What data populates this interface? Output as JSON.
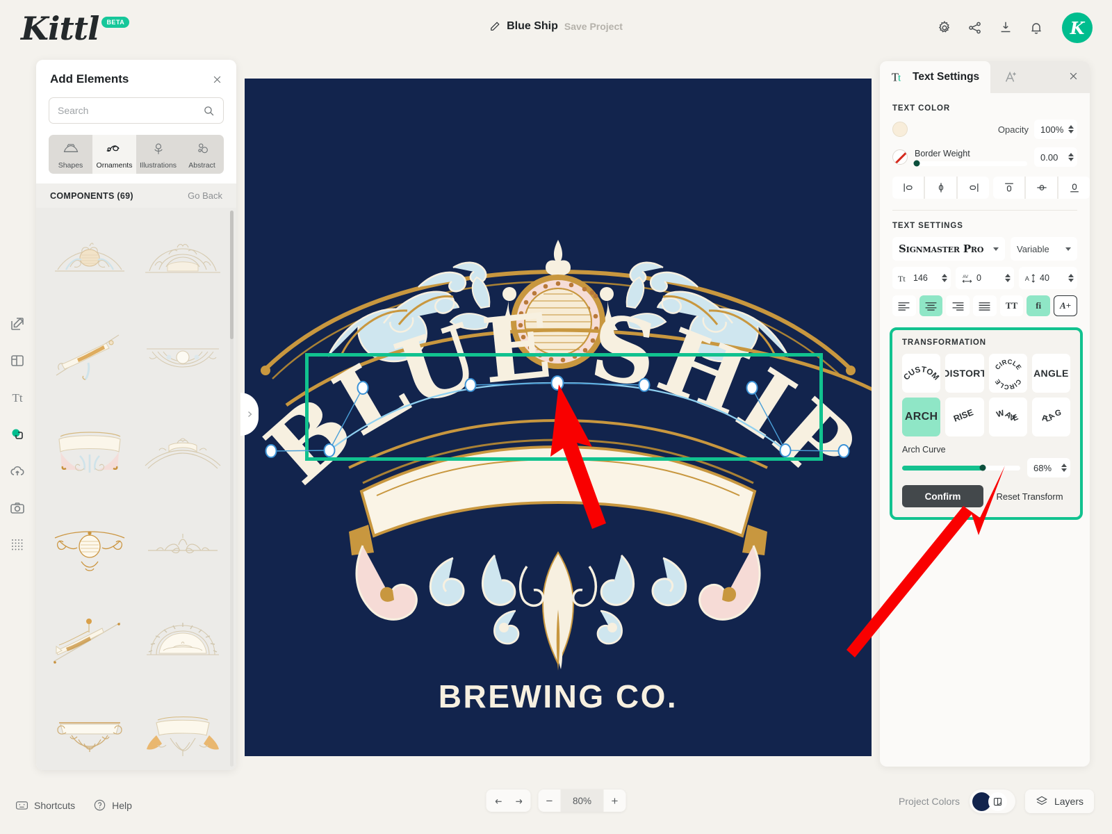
{
  "header": {
    "logo_text": "Kittl",
    "beta_badge": "BETA",
    "project_title": "Blue Ship",
    "save_label": "Save Project",
    "icons": [
      "gear-icon",
      "share-icon",
      "download-icon",
      "bell-icon"
    ],
    "avatar_letter": "K"
  },
  "rail": {
    "items": [
      {
        "name": "edit-tool",
        "icon": "pencil-square-icon"
      },
      {
        "name": "templates-tool",
        "icon": "layout-icon"
      },
      {
        "name": "text-tool",
        "icon": "text-icon"
      },
      {
        "name": "elements-tool",
        "icon": "shapes-icon"
      },
      {
        "name": "uploads-tool",
        "icon": "cloud-upload-icon"
      },
      {
        "name": "photos-tool",
        "icon": "camera-icon"
      },
      {
        "name": "textures-tool",
        "icon": "grid-dots-icon"
      }
    ]
  },
  "add_elements": {
    "title": "Add Elements",
    "search_placeholder": "Search",
    "search_value": "",
    "categories": [
      {
        "label": "Shapes",
        "icon": "shapes-icon",
        "active": false
      },
      {
        "label": "Ornaments",
        "icon": "ornament-swirl-icon",
        "active": true
      },
      {
        "label": "Illustrations",
        "icon": "flower-icon",
        "active": false
      },
      {
        "label": "Abstract",
        "icon": "abstract-blobs-icon",
        "active": false
      }
    ],
    "components_label": "COMPONENTS (69)",
    "go_back_label": "Go Back",
    "thumbnails": [
      {
        "name": "ornament-crown-oval"
      },
      {
        "name": "ornament-filigree-arch"
      },
      {
        "name": "ornament-diagonal-banner"
      },
      {
        "name": "ornament-fan-medallion"
      },
      {
        "name": "ornament-scroll-banner"
      },
      {
        "name": "ornament-small-crown-arch"
      },
      {
        "name": "ornament-oval-wings"
      },
      {
        "name": "ornament-flourish-divider"
      },
      {
        "name": "ornament-flag-banner"
      },
      {
        "name": "ornament-sunburst-arch"
      },
      {
        "name": "ornament-plaque-base"
      },
      {
        "name": "ornament-ribbon-scroll"
      }
    ]
  },
  "canvas": {
    "artwork_title": "BLUE SHIP",
    "artwork_subtitle": "BREWING CO.",
    "background_color": "#12244d",
    "cream_color": "#f7f0e0",
    "gold_color": "#c8973f",
    "lightblue_color": "#cfe6ef",
    "pink_color": "#f6dbd6",
    "selection_color": "#11c28f",
    "annotation_arrow_color": "#f90000"
  },
  "text_settings": {
    "tab_label": "Text Settings",
    "tab_icon": "Tt",
    "tab2_icon": "text-effects-icon",
    "close_icon": "close-icon",
    "text_color_label": "TEXT COLOR",
    "text_color_swatch": "#f8edda",
    "opacity_label": "Opacity",
    "opacity_value": "100%",
    "border_weight_label": "Border Weight",
    "border_weight_value": "0.00",
    "border_color": "none",
    "align_buttons": [
      {
        "name": "align-left-edge",
        "icon": "align-h-left-icon"
      },
      {
        "name": "align-h-center",
        "icon": "align-h-center-icon"
      },
      {
        "name": "align-right-edge",
        "icon": "align-h-right-icon"
      },
      {
        "name": "align-top-edge",
        "icon": "align-v-top-icon"
      },
      {
        "name": "align-v-center",
        "icon": "align-v-center-icon"
      },
      {
        "name": "align-bottom-edge",
        "icon": "align-v-bottom-icon"
      }
    ],
    "settings_label": "TEXT SETTINGS",
    "font_family": "Signmaster Pro",
    "font_variant": "Variable",
    "font_size_label": "Tt",
    "font_size": "146",
    "letter_spacing_label": "AV",
    "letter_spacing": "0",
    "line_height_label": "A",
    "line_height": "40",
    "paragraph_buttons": [
      {
        "name": "text-align-left",
        "icon": "align-text-left-icon",
        "active": false
      },
      {
        "name": "text-align-center",
        "icon": "align-text-center-icon",
        "active": true
      },
      {
        "name": "text-align-right",
        "icon": "align-text-right-icon",
        "active": false
      },
      {
        "name": "text-align-justify",
        "icon": "align-text-justify-icon",
        "active": false
      },
      {
        "name": "uppercase-toggle",
        "label": "TT",
        "active": false
      },
      {
        "name": "ligatures-toggle",
        "label": "fi",
        "active": true
      },
      {
        "name": "text-effects-button",
        "label": "A+",
        "active": false
      }
    ]
  },
  "transformation": {
    "label": "TRANSFORMATION",
    "presets": [
      {
        "name": "custom",
        "label": "CUSTOM",
        "style": "arch",
        "active": false
      },
      {
        "name": "distort",
        "label": "DISTORT",
        "style": "flat",
        "active": false
      },
      {
        "name": "circle",
        "label": "CIRCLE",
        "style": "circle",
        "active": false
      },
      {
        "name": "angle",
        "label": "ANGLE",
        "style": "flat",
        "active": false
      },
      {
        "name": "arch",
        "label": "ARCH",
        "style": "flat",
        "active": true
      },
      {
        "name": "rise",
        "label": "RISE",
        "style": "rise",
        "active": false
      },
      {
        "name": "wave",
        "label": "WAVE",
        "style": "wave",
        "active": false
      },
      {
        "name": "flag",
        "label": "FLAG",
        "style": "flag",
        "active": false
      }
    ],
    "arch_curve_label": "Arch Curve",
    "arch_curve_value": "68%",
    "arch_curve_percent": 68,
    "confirm_label": "Confirm",
    "reset_label": "Reset Transform"
  },
  "bottom": {
    "shortcuts_label": "Shortcuts",
    "help_label": "Help",
    "undo_icon": "undo-arrow-icon",
    "redo_icon": "redo-arrow-icon",
    "zoom_out_label": "−",
    "zoom_value": "80%",
    "zoom_in_label": "+",
    "project_colors_label": "Project Colors",
    "layers_label": "Layers"
  }
}
